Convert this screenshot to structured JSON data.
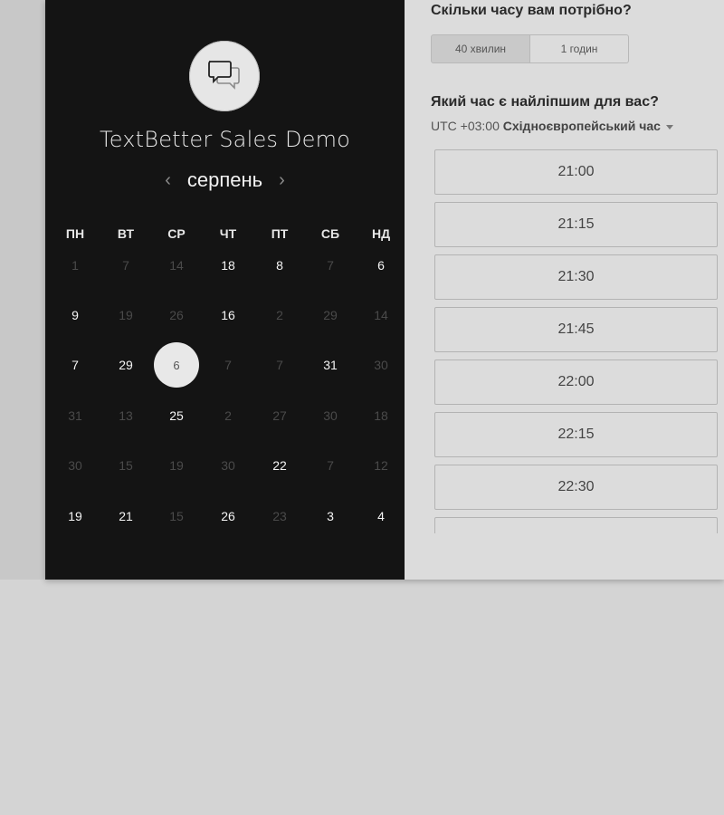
{
  "event": {
    "title": "TextBetter Sales Demo",
    "icon": "chat-bubbles-icon"
  },
  "calendar": {
    "month": "серпень",
    "prev_arrow": "‹",
    "next_arrow": "›",
    "weekdays": [
      "ПН",
      "ВТ",
      "СР",
      "ЧТ",
      "ПТ",
      "СБ",
      "НД"
    ],
    "weeks": [
      [
        {
          "d": "1",
          "m": true
        },
        {
          "d": "7",
          "m": true
        },
        {
          "d": "14",
          "m": true
        },
        {
          "d": "18",
          "m": false
        },
        {
          "d": "8",
          "m": false
        },
        {
          "d": "7",
          "m": true
        },
        {
          "d": "6",
          "m": false
        }
      ],
      [
        {
          "d": "9",
          "m": false
        },
        {
          "d": "19",
          "m": true
        },
        {
          "d": "26",
          "m": true
        },
        {
          "d": "16",
          "m": false
        },
        {
          "d": "2",
          "m": true
        },
        {
          "d": "29",
          "m": true
        },
        {
          "d": "14",
          "m": true
        }
      ],
      [
        {
          "d": "7",
          "m": false
        },
        {
          "d": "29",
          "m": false
        },
        {
          "d": "6",
          "m": false,
          "sel": true
        },
        {
          "d": "7",
          "m": true
        },
        {
          "d": "7",
          "m": true
        },
        {
          "d": "31",
          "m": false
        },
        {
          "d": "30",
          "m": true
        }
      ],
      [
        {
          "d": "31",
          "m": true
        },
        {
          "d": "13",
          "m": true
        },
        {
          "d": "25",
          "m": false
        },
        {
          "d": "2",
          "m": true
        },
        {
          "d": "27",
          "m": true
        },
        {
          "d": "30",
          "m": true
        },
        {
          "d": "18",
          "m": true
        }
      ],
      [
        {
          "d": "30",
          "m": true
        },
        {
          "d": "15",
          "m": true
        },
        {
          "d": "19",
          "m": true
        },
        {
          "d": "30",
          "m": true
        },
        {
          "d": "22",
          "m": false
        },
        {
          "d": "7",
          "m": true
        },
        {
          "d": "12",
          "m": true
        }
      ],
      [
        {
          "d": "19",
          "m": false
        },
        {
          "d": "21",
          "m": false
        },
        {
          "d": "15",
          "m": true
        },
        {
          "d": "26",
          "m": false
        },
        {
          "d": "23",
          "m": true
        },
        {
          "d": "3",
          "m": false
        },
        {
          "d": "4",
          "m": false
        }
      ]
    ]
  },
  "duration": {
    "question": "Скільки часу вам потрібно?",
    "options": [
      {
        "label": "40 хвилин",
        "active": true
      },
      {
        "label": "1 годин",
        "active": false
      }
    ]
  },
  "time": {
    "question": "Який час є найліпшим для вас?",
    "tz_offset": "UTC +03:00",
    "tz_name": "Східноєвропейський час",
    "slots": [
      "21:00",
      "21:15",
      "21:30",
      "21:45",
      "22:00",
      "22:15",
      "22:30",
      ""
    ]
  }
}
